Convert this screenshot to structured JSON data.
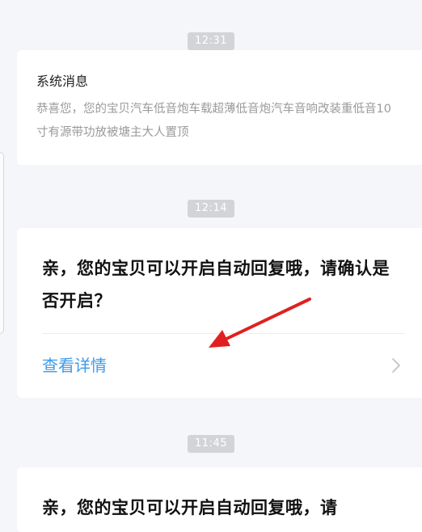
{
  "messages": [
    {
      "time": "12:31",
      "title": "系统消息",
      "body": "恭喜您，您的宝贝汽车低音炮车载超薄低音炮汽车音响改装重低音10寸有源带功放被塘主大人置顶"
    },
    {
      "time": "12:14",
      "text": "亲，您的宝贝可以开启自动回复哦，请确认是否开启？",
      "link_label": "查看详情"
    },
    {
      "time": "11:45",
      "text": "亲，您的宝贝可以开启自动回复哦，请"
    }
  ],
  "colors": {
    "background": "#f5f6fa",
    "link": "#3d9be9",
    "annotation_arrow": "#e02020",
    "timestamp_bg": "#d3d4d8"
  },
  "icons": {
    "chevron": "chevron-right-icon"
  }
}
